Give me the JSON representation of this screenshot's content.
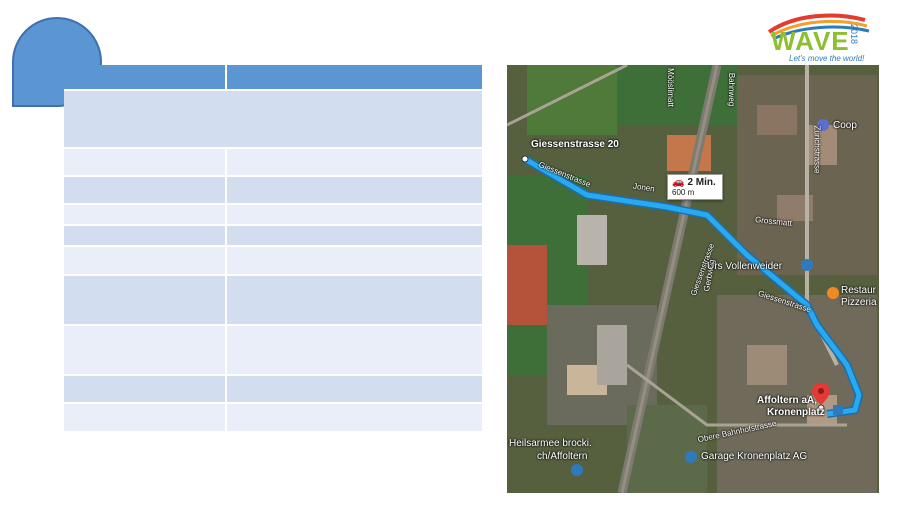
{
  "slide": {
    "background": "#ffffff"
  },
  "accent_color": "#5b96d3",
  "table": {
    "header": [
      "",
      ""
    ],
    "rows": [
      [
        "",
        ""
      ],
      [
        "",
        ""
      ],
      [
        "",
        ""
      ],
      [
        "",
        ""
      ],
      [
        "",
        ""
      ],
      [
        "",
        ""
      ],
      [
        "",
        ""
      ],
      [
        "",
        ""
      ],
      [
        "",
        ""
      ],
      [
        "",
        ""
      ]
    ]
  },
  "logo": {
    "word": "WAVE",
    "year": "2018",
    "tagline": "Let's move the world!"
  },
  "map": {
    "start_label": "Giessenstrasse 20",
    "route_time": "2 Min.",
    "route_distance": "600 m",
    "destination_line1": "Affoltern aA,",
    "destination_line2": "Kronenplatz",
    "places": {
      "coop": "Coop",
      "urs": "Urs Vollenweider",
      "restaurant": "Restaur",
      "pizzeria": "Pizzeria",
      "grossmatt": "Grossmatt",
      "heilsarmee1": "Heilsarmee brocki.",
      "heilsarmee2": "ch/Affoltern",
      "garage": "Garage Kronenplatz AG"
    },
    "streets": {
      "giessenstrasse_a": "Giessenstrasse",
      "giessenstrasse_b": "Giessenstrasse",
      "giessenstrasse_c": "Giessenstrasse",
      "zurichstrasse": "Zürichstrasse",
      "bahnweg": "Bahnweg",
      "gerbweg": "Gerbweg",
      "obere_bahnhof": "Obere Bahnhofstrasse",
      "jonen": "Jonen",
      "moosmatt": "Mööslimatt"
    },
    "route_color": "#28aaf0"
  }
}
